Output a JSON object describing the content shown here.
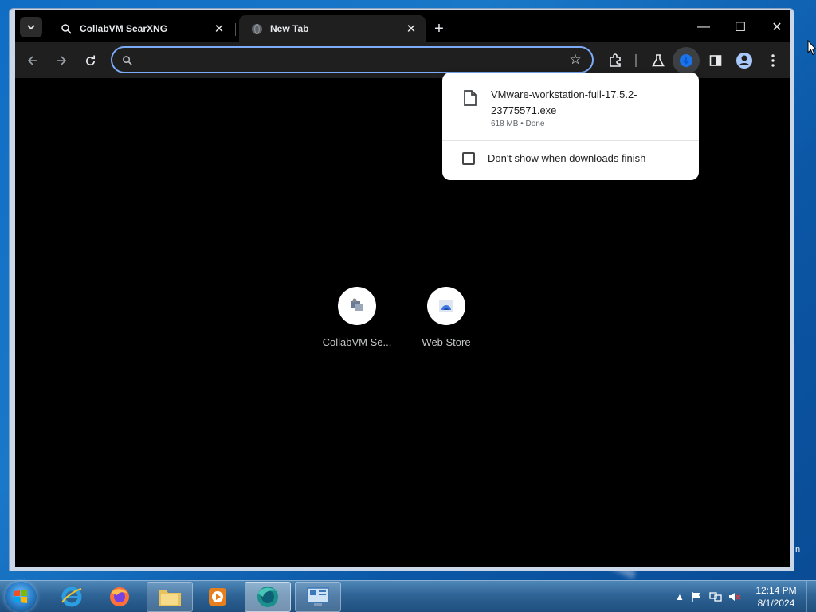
{
  "browser": {
    "tabs": [
      {
        "title": "CollabVM SearXNG",
        "active": false,
        "favicon": "searxng-icon"
      },
      {
        "title": "New Tab",
        "active": true,
        "favicon": "globe-icon"
      }
    ],
    "omnibox": {
      "value": "",
      "placeholder": ""
    },
    "window_controls": {
      "minimize": "—",
      "maximize": "☐",
      "close": "✕"
    }
  },
  "new_tab": {
    "shortcuts": [
      {
        "label": "CollabVM Se...",
        "icon": "collabvm-icon"
      },
      {
        "label": "Web Store",
        "icon": "webstore-icon"
      }
    ]
  },
  "download_bubble": {
    "file_name": "VMware-workstation-full-17.5.2-23775571.exe",
    "status": "618 MB • Done",
    "checkbox_label": "Don't show when downloads finish",
    "checkbox_checked": false
  },
  "taskbar": {
    "apps": [
      "internet-explorer",
      "firefox",
      "file-explorer",
      "media-player",
      "chrome",
      "control-panel"
    ],
    "clock_time": "12:14 PM",
    "clock_date": "8/1/2024"
  },
  "desktop": {
    "edge_text": "n"
  },
  "colors": {
    "accent": "#7cacf8",
    "toolbar": "#1f1f1f",
    "titlebar": "#000000",
    "content_bg": "#000000"
  }
}
